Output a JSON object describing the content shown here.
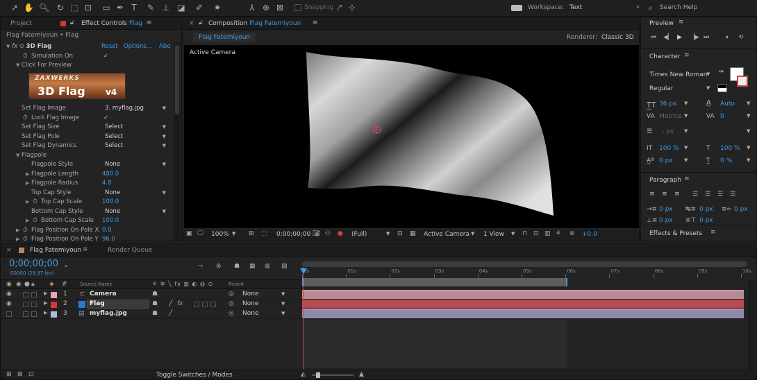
{
  "toolbar": {
    "snapping_label": "Snapping",
    "workspace_label": "Workspace:",
    "workspace_value": "Text",
    "search_placeholder": "Search Help"
  },
  "project_tab": "Project",
  "effect_controls": {
    "tab_prefix": "Effect Controls",
    "tab_layer": "Flag",
    "breadcrumb": "Flag Fatemiyoun • Flag",
    "effect_name": "3D Flag",
    "reset": "Reset",
    "options": "Options...",
    "about": "Abo",
    "logo_top": "ZAXWERKS",
    "logo_main": "3D Flag",
    "logo_version": "v4",
    "rows": [
      {
        "label": "Simulation On",
        "value": "✓"
      },
      {
        "label": "Click For Preview",
        "value": ""
      },
      {
        "label": "Set Flag Image",
        "value": "3. myflag.jpg"
      },
      {
        "label": "Lock Flag Image",
        "value": "✓"
      },
      {
        "label": "Set Flag Size",
        "value": "Select"
      },
      {
        "label": "Set Flag Pole",
        "value": "Select"
      },
      {
        "label": "Set Flag Dynamics",
        "value": "Select"
      },
      {
        "label": "Flagpole",
        "value": ""
      },
      {
        "label": "Flagpole Style",
        "value": "None"
      },
      {
        "label": "Flagpole Length",
        "value": "480.0"
      },
      {
        "label": "Flagpole Radius",
        "value": "4.8"
      },
      {
        "label": "Top Cap Style",
        "value": "None"
      },
      {
        "label": "Top Cap Scale",
        "value": "100.0"
      },
      {
        "label": "Bottom Cap Style",
        "value": "None"
      },
      {
        "label": "Bottom Cap Scale",
        "value": "100.0"
      },
      {
        "label": "Flag Position On Pole X",
        "value": "0.0"
      },
      {
        "label": "Flag Position On Pole Y",
        "value": "96.0"
      }
    ]
  },
  "composition": {
    "tab_prefix": "Composition",
    "tab_name": "Flag Fatemiyoun",
    "subtab": "Flag Fatemiyoun",
    "renderer_label": "Renderer:",
    "renderer_value": "Classic 3D",
    "camera_label": "Active Camera",
    "zoom": "100%",
    "timecode": "0;00;00;00",
    "resolution": "(Full)",
    "view_camera": "Active Camera",
    "view_count": "1 View",
    "exposure": "+0.0"
  },
  "preview": {
    "title": "Preview"
  },
  "character": {
    "title": "Character",
    "font": "Times New Roman",
    "style": "Regular",
    "size": "36 px",
    "leading": "Auto",
    "kerning": "Metrics",
    "tracking": "0",
    "stroke": "- px",
    "vscale": "100 %",
    "hscale": "100 %",
    "baseline": "0 px",
    "tsume": "0 %"
  },
  "paragraph": {
    "title": "Paragraph",
    "indent_left": "0 px",
    "indent_first": "0 px",
    "indent_right": "0 px",
    "space_before": "0 px",
    "space_after": "0 px"
  },
  "effects_presets": {
    "title": "Effects & Presets"
  },
  "timeline": {
    "tab": "Flag Fatemiyoun",
    "render_queue": "Render Queue",
    "timecode": "0;00;00;00",
    "fps": "00000 (29.97 fps)",
    "col_source": "Source Name",
    "col_parent": "Parent",
    "ruler": [
      "0s",
      "01s",
      "02s",
      "03s",
      "04s",
      "05s",
      "06s",
      "07s",
      "08s",
      "09s",
      "10s"
    ],
    "layers": [
      {
        "num": "1",
        "name": "Camera",
        "parent": "None",
        "color": "#e8a2b0",
        "bar": "#b38d93"
      },
      {
        "num": "2",
        "name": "Flag",
        "parent": "None",
        "color": "#d03a3a",
        "bar": "#b54c52"
      },
      {
        "num": "3",
        "name": "myflag.jpg",
        "parent": "None",
        "color": "#b9b4dd",
        "bar": "#8f8aa8"
      }
    ],
    "toggle_label": "Toggle Switches / Modes"
  }
}
